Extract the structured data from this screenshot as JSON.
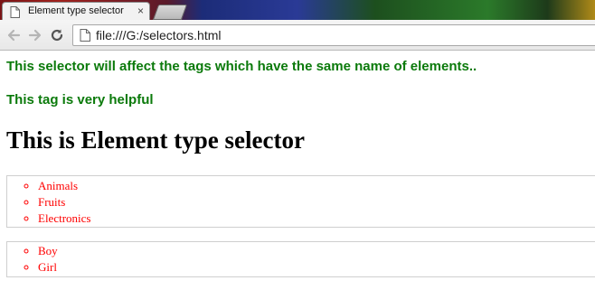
{
  "tab": {
    "title": "Element type selector",
    "close": "×"
  },
  "address_bar": {
    "url": "file:///G:/selectors.html"
  },
  "page": {
    "paragraph1": "This selector will affect the tags which have the same name of elements..",
    "paragraph2": "This tag is very helpful",
    "heading": "This is Element type selector",
    "list1": [
      "Animals",
      "Fruits",
      "Electronics"
    ],
    "list2": [
      "Boy",
      "Girl"
    ]
  },
  "colors": {
    "paragraph": "#0b7a0b",
    "list": "#ff0000",
    "heading": "#000000"
  },
  "icons": [
    "page-icon",
    "back-arrow-icon",
    "forward-arrow-icon",
    "reload-icon",
    "close-icon"
  ]
}
